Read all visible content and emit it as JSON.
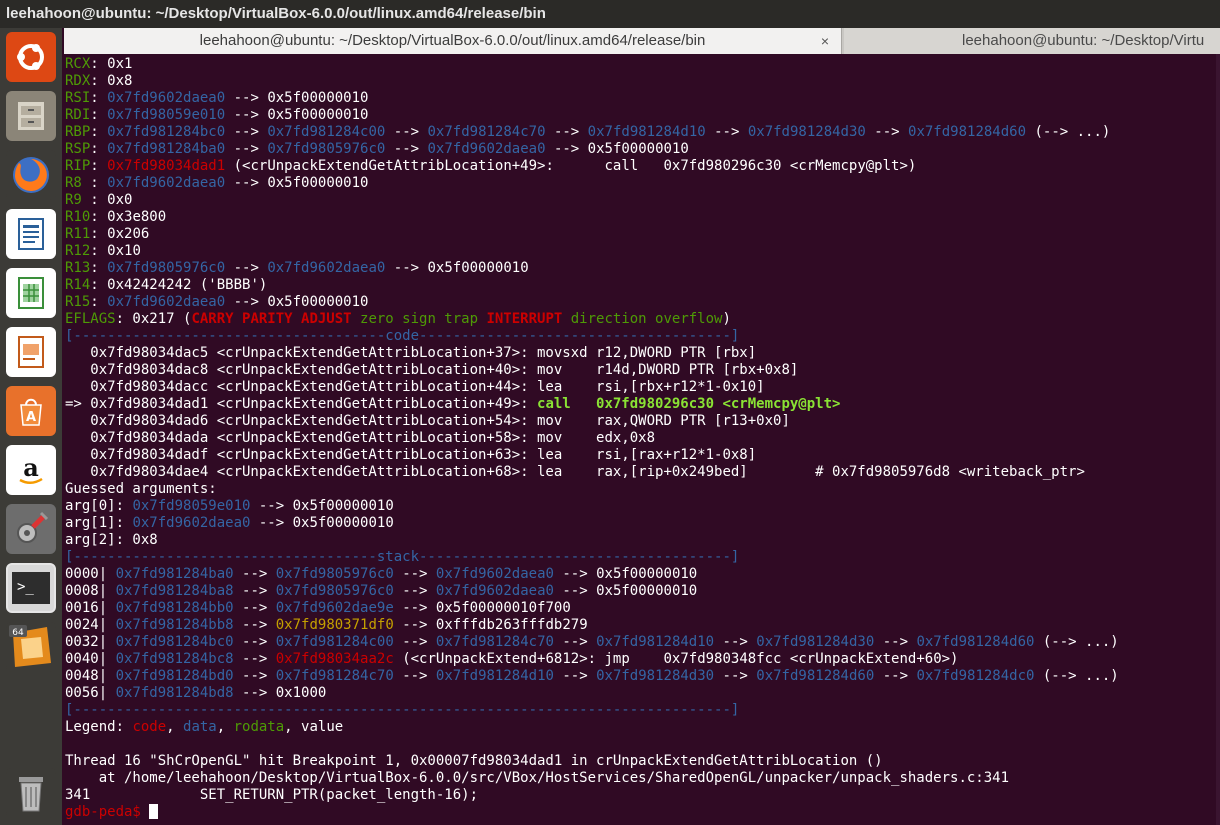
{
  "window_title": "leehahoon@ubuntu: ~/Desktop/VirtualBox-6.0.0/out/linux.amd64/release/bin",
  "tabs": [
    {
      "label": "leehahoon@ubuntu: ~/Desktop/VirtualBox-6.0.0/out/linux.amd64/release/bin",
      "close": "×"
    },
    {
      "label": "leehahoon@ubuntu: ~/Desktop/Virtu"
    }
  ],
  "launcher": [
    {
      "name": "ubuntu-logo-icon",
      "color": "#dd4814"
    },
    {
      "name": "file-cabinet-icon",
      "color": "#a39c8e"
    },
    {
      "name": "firefox-icon",
      "color": "#e66000"
    },
    {
      "name": "writer-icon",
      "color": "#2a6099"
    },
    {
      "name": "calc-icon",
      "color": "#3a8f3a"
    },
    {
      "name": "impress-icon",
      "color": "#c25a1a"
    },
    {
      "name": "software-center-icon",
      "color": "#e8712b"
    },
    {
      "name": "amazon-icon",
      "color": "#ffffff"
    },
    {
      "name": "settings-icon",
      "color": "#8c8c8c"
    },
    {
      "name": "terminal-icon",
      "color": "#2d2d2d"
    },
    {
      "name": "virtualbox-icon",
      "color": "#e48a1c"
    },
    {
      "name": "trash-icon",
      "color": "#7a7a7a"
    }
  ],
  "launcher_labels": {
    "vbox_badge": "64"
  },
  "terminal": {
    "lines": [
      [
        [
          "RCX",
          "g"
        ],
        [
          ": 0x1",
          ""
        ]
      ],
      [
        [
          "RDX",
          "g"
        ],
        [
          ": 0x8",
          ""
        ]
      ],
      [
        [
          "RSI",
          "g"
        ],
        [
          ": ",
          ""
        ],
        [
          "0x7fd9602daea0",
          "b"
        ],
        [
          " --> 0x5f00000010",
          ""
        ]
      ],
      [
        [
          "RDI",
          "g"
        ],
        [
          ": ",
          ""
        ],
        [
          "0x7fd98059e010",
          "b"
        ],
        [
          " --> 0x5f00000010",
          ""
        ]
      ],
      [
        [
          "RBP",
          "g"
        ],
        [
          ": ",
          ""
        ],
        [
          "0x7fd981284bc0",
          "b"
        ],
        [
          " --> ",
          ""
        ],
        [
          "0x7fd981284c00",
          "b"
        ],
        [
          " --> ",
          ""
        ],
        [
          "0x7fd981284c70",
          "b"
        ],
        [
          " --> ",
          ""
        ],
        [
          "0x7fd981284d10",
          "b"
        ],
        [
          " --> ",
          ""
        ],
        [
          "0x7fd981284d30",
          "b"
        ],
        [
          " --> ",
          ""
        ],
        [
          "0x7fd981284d60",
          "b"
        ],
        [
          " (--> ...)",
          ""
        ]
      ],
      [
        [
          "RSP",
          "g"
        ],
        [
          ": ",
          ""
        ],
        [
          "0x7fd981284ba0",
          "b"
        ],
        [
          " --> ",
          ""
        ],
        [
          "0x7fd9805976c0",
          "b"
        ],
        [
          " --> ",
          ""
        ],
        [
          "0x7fd9602daea0",
          "b"
        ],
        [
          " --> 0x5f00000010",
          ""
        ]
      ],
      [
        [
          "RIP",
          "g"
        ],
        [
          ": ",
          ""
        ],
        [
          "0x7fd98034dad1",
          "r"
        ],
        [
          " (<crUnpackExtendGetAttribLocation+49>:      call   0x7fd980296c30 <crMemcpy@plt>)",
          ""
        ]
      ],
      [
        [
          "R8 ",
          "g"
        ],
        [
          ": ",
          ""
        ],
        [
          "0x7fd9602daea0",
          "b"
        ],
        [
          " --> 0x5f00000010",
          ""
        ]
      ],
      [
        [
          "R9 ",
          "g"
        ],
        [
          ": 0x0",
          ""
        ]
      ],
      [
        [
          "R10",
          "g"
        ],
        [
          ": 0x3e800",
          ""
        ]
      ],
      [
        [
          "R11",
          "g"
        ],
        [
          ": 0x206",
          ""
        ]
      ],
      [
        [
          "R12",
          "g"
        ],
        [
          ": 0x10",
          ""
        ]
      ],
      [
        [
          "R13",
          "g"
        ],
        [
          ": ",
          ""
        ],
        [
          "0x7fd9805976c0",
          "b"
        ],
        [
          " --> ",
          ""
        ],
        [
          "0x7fd9602daea0",
          "b"
        ],
        [
          " --> 0x5f00000010",
          ""
        ]
      ],
      [
        [
          "R14",
          "g"
        ],
        [
          ": 0x42424242 ('BBBB')",
          ""
        ]
      ],
      [
        [
          "R15",
          "g"
        ],
        [
          ": ",
          ""
        ],
        [
          "0x7fd9602daea0",
          "b"
        ],
        [
          " --> 0x5f00000010",
          ""
        ]
      ],
      [
        [
          "EFLAGS",
          "g"
        ],
        [
          ": 0x217 (",
          ""
        ],
        [
          "CARRY PARITY ADJUST",
          "rb"
        ],
        [
          " zero sign trap ",
          "g"
        ],
        [
          "INTERRUPT",
          "rb"
        ],
        [
          " direction overflow",
          "g"
        ],
        [
          ")",
          ""
        ]
      ],
      [
        [
          "[-------------------------------------code-------------------------------------]",
          "b"
        ]
      ],
      [
        [
          "   0x7fd98034dac5 <crUnpackExtendGetAttribLocation+37>: movsxd r12,DWORD PTR [rbx]",
          ""
        ]
      ],
      [
        [
          "   0x7fd98034dac8 <crUnpackExtendGetAttribLocation+40>: mov    r14d,DWORD PTR [rbx+0x8]",
          ""
        ]
      ],
      [
        [
          "   0x7fd98034dacc <crUnpackExtendGetAttribLocation+44>: lea    rsi,[rbx+r12*1-0x10]",
          ""
        ]
      ],
      [
        [
          "=> 0x7fd98034dad1 <crUnpackExtendGetAttribLocation+49>: ",
          ""
        ],
        [
          "call   0x7fd980296c30 <crMemcpy@plt>",
          "gb"
        ]
      ],
      [
        [
          "   0x7fd98034dad6 <crUnpackExtendGetAttribLocation+54>: mov    rax,QWORD PTR [r13+0x0]",
          ""
        ]
      ],
      [
        [
          "   0x7fd98034dada <crUnpackExtendGetAttribLocation+58>: mov    edx,0x8",
          ""
        ]
      ],
      [
        [
          "   0x7fd98034dadf <crUnpackExtendGetAttribLocation+63>: lea    rsi,[rax+r12*1-0x8]",
          ""
        ]
      ],
      [
        [
          "   0x7fd98034dae4 <crUnpackExtendGetAttribLocation+68>: lea    rax,[rip+0x249bed]        # 0x7fd9805976d8 <writeback_ptr>",
          ""
        ]
      ],
      [
        [
          "Guessed arguments:",
          ""
        ]
      ],
      [
        [
          "arg[0]: ",
          ""
        ],
        [
          "0x7fd98059e010",
          "b"
        ],
        [
          " --> 0x5f00000010",
          ""
        ]
      ],
      [
        [
          "arg[1]: ",
          ""
        ],
        [
          "0x7fd9602daea0",
          "b"
        ],
        [
          " --> 0x5f00000010",
          ""
        ]
      ],
      [
        [
          "arg[2]: 0x8",
          ""
        ]
      ],
      [
        [
          "[------------------------------------stack-------------------------------------]",
          "b"
        ]
      ],
      [
        [
          "0000| ",
          ""
        ],
        [
          "0x7fd981284ba0",
          "b"
        ],
        [
          " --> ",
          ""
        ],
        [
          "0x7fd9805976c0",
          "b"
        ],
        [
          " --> ",
          ""
        ],
        [
          "0x7fd9602daea0",
          "b"
        ],
        [
          " --> 0x5f00000010",
          ""
        ]
      ],
      [
        [
          "0008| ",
          ""
        ],
        [
          "0x7fd981284ba8",
          "b"
        ],
        [
          " --> ",
          ""
        ],
        [
          "0x7fd9805976c0",
          "b"
        ],
        [
          " --> ",
          ""
        ],
        [
          "0x7fd9602daea0",
          "b"
        ],
        [
          " --> 0x5f00000010",
          ""
        ]
      ],
      [
        [
          "0016| ",
          ""
        ],
        [
          "0x7fd981284bb0",
          "b"
        ],
        [
          " --> ",
          ""
        ],
        [
          "0x7fd9602dae9e",
          "b"
        ],
        [
          " --> 0x5f00000010f700",
          ""
        ]
      ],
      [
        [
          "0024| ",
          ""
        ],
        [
          "0x7fd981284bb8",
          "b"
        ],
        [
          " --> ",
          ""
        ],
        [
          "0x7fd980371df0",
          "y"
        ],
        [
          " --> 0xfffdb263fffdb279",
          ""
        ]
      ],
      [
        [
          "0032| ",
          ""
        ],
        [
          "0x7fd981284bc0",
          "b"
        ],
        [
          " --> ",
          ""
        ],
        [
          "0x7fd981284c00",
          "b"
        ],
        [
          " --> ",
          ""
        ],
        [
          "0x7fd981284c70",
          "b"
        ],
        [
          " --> ",
          ""
        ],
        [
          "0x7fd981284d10",
          "b"
        ],
        [
          " --> ",
          ""
        ],
        [
          "0x7fd981284d30",
          "b"
        ],
        [
          " --> ",
          ""
        ],
        [
          "0x7fd981284d60",
          "b"
        ],
        [
          " (--> ...)",
          ""
        ]
      ],
      [
        [
          "0040| ",
          ""
        ],
        [
          "0x7fd981284bc8",
          "b"
        ],
        [
          " --> ",
          ""
        ],
        [
          "0x7fd98034aa2c",
          "r"
        ],
        [
          " (<crUnpackExtend+6812>: jmp    0x7fd980348fcc <crUnpackExtend+60>)",
          ""
        ]
      ],
      [
        [
          "0048| ",
          ""
        ],
        [
          "0x7fd981284bd0",
          "b"
        ],
        [
          " --> ",
          ""
        ],
        [
          "0x7fd981284c70",
          "b"
        ],
        [
          " --> ",
          ""
        ],
        [
          "0x7fd981284d10",
          "b"
        ],
        [
          " --> ",
          ""
        ],
        [
          "0x7fd981284d30",
          "b"
        ],
        [
          " --> ",
          ""
        ],
        [
          "0x7fd981284d60",
          "b"
        ],
        [
          " --> ",
          ""
        ],
        [
          "0x7fd981284dc0",
          "b"
        ],
        [
          " (--> ...)",
          ""
        ]
      ],
      [
        [
          "0056| ",
          ""
        ],
        [
          "0x7fd981284bd8",
          "b"
        ],
        [
          " --> 0x1000",
          ""
        ]
      ],
      [
        [
          "[------------------------------------------------------------------------------]",
          "b"
        ]
      ],
      [
        [
          "Legend: ",
          ""
        ],
        [
          "code",
          "r"
        ],
        [
          ", ",
          ""
        ],
        [
          "data",
          "b"
        ],
        [
          ", ",
          ""
        ],
        [
          "rodata",
          "g"
        ],
        [
          ", value",
          ""
        ]
      ],
      [
        [
          "",
          ""
        ]
      ],
      [
        [
          "Thread 16 \"ShCrOpenGL\" hit Breakpoint 1, 0x00007fd98034dad1 in crUnpackExtendGetAttribLocation ()",
          ""
        ]
      ],
      [
        [
          "    at /home/leehahoon/Desktop/VirtualBox-6.0.0/src/VBox/HostServices/SharedOpenGL/unpacker/unpack_shaders.c:341",
          ""
        ]
      ],
      [
        [
          "341             SET_RETURN_PTR(packet_length-16);",
          ""
        ]
      ]
    ],
    "prompt": "gdb-peda$ "
  }
}
